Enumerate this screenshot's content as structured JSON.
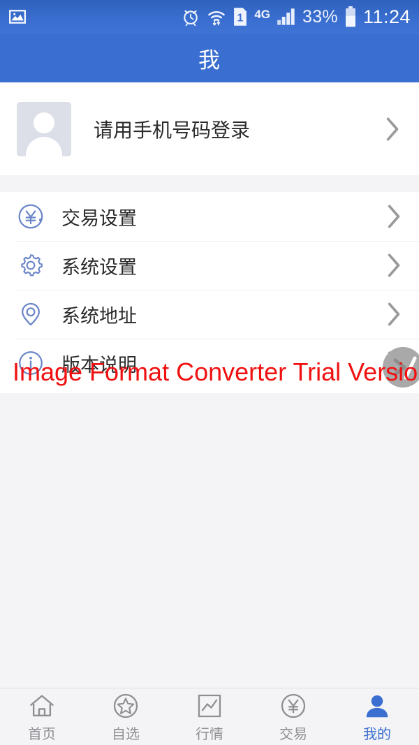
{
  "status_bar": {
    "left_icons": [
      {
        "name": "gallery-icon",
        "glyph": "image"
      }
    ],
    "right_icons": [
      {
        "name": "alarm-clock-icon",
        "glyph": "alarm"
      },
      {
        "name": "wifi-icon",
        "glyph": "wifi-transfer"
      },
      {
        "name": "sim-card-icon",
        "glyph": "sim",
        "label": "1"
      },
      {
        "name": "network-type-label",
        "label": "4G"
      },
      {
        "name": "signal-bars-icon",
        "glyph": "signal"
      }
    ],
    "battery_percent": "33%",
    "battery_icon_name": "battery-icon",
    "time": "11:24"
  },
  "header": {
    "title": "我"
  },
  "profile": {
    "avatar_name": "avatar-placeholder",
    "login_label": "请用手机号码登录",
    "chevron_name": "chevron-right-icon"
  },
  "menu": {
    "items": [
      {
        "label": "交易设置",
        "icon": "yuan-circle-icon",
        "key": "trade-settings"
      },
      {
        "label": "系统设置",
        "icon": "gear-icon",
        "key": "system-settings"
      },
      {
        "label": "系统地址",
        "icon": "location-pin-icon",
        "key": "system-address"
      },
      {
        "label": "版本说明",
        "icon": "info-circle-icon",
        "key": "version-notes"
      }
    ]
  },
  "watermark": {
    "text": "Image Format Converter Trial Version.",
    "color": "#f01010",
    "badge_name": "watermark-badge-icon"
  },
  "bottom_nav": {
    "items": [
      {
        "label": "首页",
        "icon": "home-icon",
        "key": "home",
        "active": false
      },
      {
        "label": "自选",
        "icon": "star-circle-icon",
        "key": "watchlist",
        "active": false
      },
      {
        "label": "行情",
        "icon": "chart-square-icon",
        "key": "market",
        "active": false
      },
      {
        "label": "交易",
        "icon": "yuan-circle-icon",
        "key": "trade",
        "active": false
      },
      {
        "label": "我的",
        "icon": "person-filled-icon",
        "key": "mine",
        "active": true
      }
    ]
  },
  "colors": {
    "header_blue": "#3a6ed0",
    "accent_blue": "#3a6ed0",
    "page_background": "#f4f4f7",
    "card_background": "#ffffff",
    "icon_outline": "#6b86c8",
    "inactive_nav": "#8e8e93",
    "watermark_red": "#f01010"
  }
}
